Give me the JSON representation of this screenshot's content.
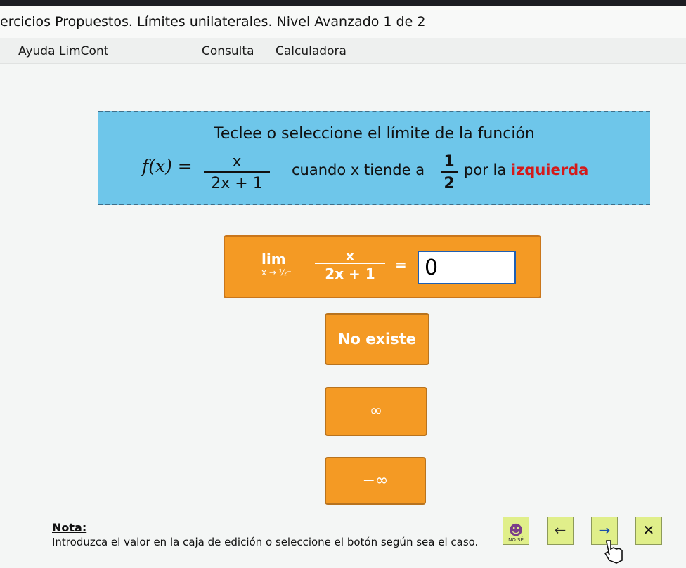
{
  "window": {
    "title": "ercicios Propuestos. Límites unilaterales. Nivel Avanzado 1 de 2"
  },
  "menu": {
    "items": [
      "Ayuda LimCont",
      "Consulta",
      "Calculadora"
    ]
  },
  "prompt": {
    "line1": "Teclee o seleccione el límite de la función",
    "fx_label": "f(x) =",
    "numerator": "x",
    "denominator": "2x + 1",
    "middle_text": "cuando x tiende a",
    "approach_num": "1",
    "approach_den": "2",
    "tail_text": "por la",
    "direction": "izquierda"
  },
  "answer": {
    "lim_word": "lim",
    "lim_sub": "x → ½⁻",
    "numerator": "x",
    "denominator": "2x + 1",
    "equals": "=",
    "input_value": "0"
  },
  "options": [
    "No existe",
    "∞",
    "−∞"
  ],
  "note": {
    "title": "Nota:",
    "text": "Introduzca el valor en la caja de edición o seleccione el botón según sea el caso."
  },
  "nav": {
    "buttons": [
      {
        "name": "help-button",
        "glyph": "☻",
        "sub": "NO SÉ"
      },
      {
        "name": "back-button",
        "glyph": "←",
        "sub": ""
      },
      {
        "name": "forward-button",
        "glyph": "→",
        "sub": ""
      },
      {
        "name": "close-button",
        "glyph": "✕",
        "sub": ""
      }
    ]
  },
  "colors": {
    "prompt_bg": "#6ec6ea",
    "option_bg": "#f49a24",
    "direction_text": "#d41a1a",
    "nav_bg": "#e0ef8a"
  },
  "icons": [
    "arrow-left-icon",
    "arrow-right-icon",
    "close-icon",
    "help-face-icon",
    "hand-cursor-icon"
  ]
}
